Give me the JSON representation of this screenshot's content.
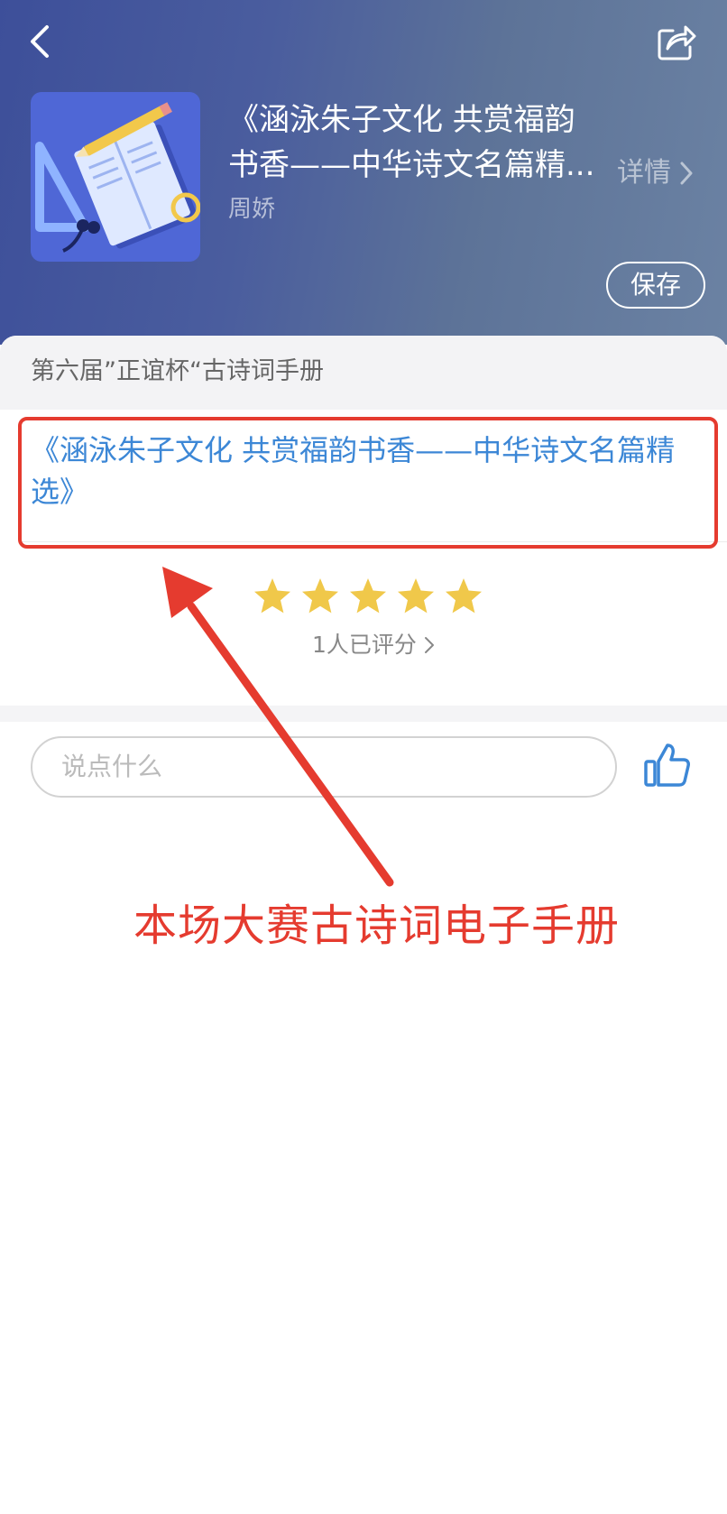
{
  "header": {
    "album_title_line1": "《涵泳朱子文化 共赏福韵",
    "album_title_line2": "书香——中华诗文名篇精...",
    "author": "周娇",
    "details_label": "详情",
    "save_label": "保存",
    "back_icon": "chevron-left-icon",
    "share_icon": "share-icon"
  },
  "section": {
    "header_label": "第六届”正谊杯“古诗词手册"
  },
  "track": {
    "title": "《涵泳朱子文化 共赏福韵书香——中华诗文名篇精选》"
  },
  "rating": {
    "stars": 5,
    "max_stars": 5,
    "count_label": "1人已评分"
  },
  "comment": {
    "placeholder": "说点什么"
  },
  "annotation": {
    "text": "本场大赛古诗词电子手册"
  },
  "colors": {
    "accent_blue": "#3c87d6",
    "annotation_red": "#e53b2f",
    "star_gold": "#f0c84a"
  }
}
